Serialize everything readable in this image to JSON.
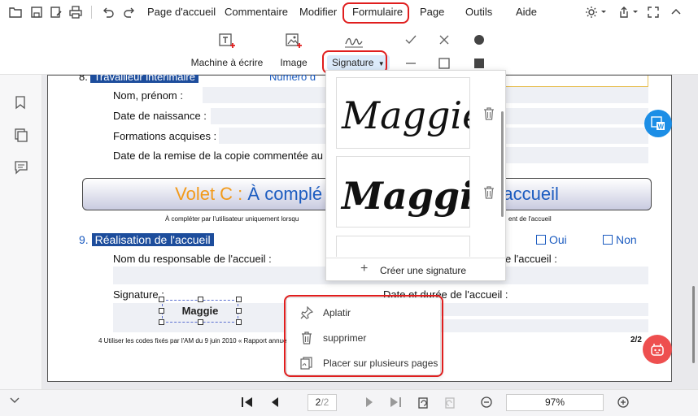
{
  "menu": {
    "items": [
      {
        "label": "Page d'accueil"
      },
      {
        "label": "Commentaire"
      },
      {
        "label": "Modifier"
      },
      {
        "label": "Formulaire"
      },
      {
        "label": "Page"
      },
      {
        "label": "Outils"
      },
      {
        "label": "Aide"
      }
    ],
    "active": "Formulaire"
  },
  "ribbon": {
    "typewriter_label": "Machine à écrire",
    "image_label": "Image",
    "signature_label": "Signature"
  },
  "document": {
    "section8_title": "Travailleur intérimaire",
    "section8_right": "Numéro d",
    "fields": {
      "name": "Nom, prénom :",
      "birth": "Date de naissance :",
      "training": "Formations acquises :",
      "copy_date": "Date de la remise de la copie commentée au t"
    },
    "volet_prefix": "Volet C :",
    "volet_text_left": "À complé",
    "volet_text_right": "accueil",
    "volet_note_left": "À compléter par l'utilisateur uniquement lorsqu",
    "volet_note_right": "ent de l'accueil",
    "section9_number": "9.",
    "section9_title": "Réalisation de l'accueil",
    "oui": "Oui",
    "non": "Non",
    "responsable": "Nom du responsable de l'accueil :",
    "responsable_right": "e l'accueil :",
    "signature_label": "Signature :",
    "date_duree": "Date et durée de l'accueil :",
    "placed_signature": "Maggie",
    "footnote": "4 Utiliser les codes fixés par l'AM du 9 juin 2010 « Rapport annuel",
    "page_marker": "2/2"
  },
  "signature_panel": {
    "signatures": [
      {
        "text": "Maggie",
        "style": "script-light"
      },
      {
        "text": "Maggie",
        "style": "script-bold"
      }
    ],
    "create_label": "Créer une signature"
  },
  "context_menu": {
    "items": [
      {
        "label": "Aplatir",
        "icon": "pin-icon"
      },
      {
        "label": "supprimer",
        "icon": "trash-icon"
      },
      {
        "label": "Placer sur plusieurs pages",
        "icon": "multi-page-icon"
      }
    ]
  },
  "bottom": {
    "page_current": "2",
    "page_total": "/2",
    "zoom": "97%"
  },
  "colors": {
    "accent_red": "#e01e1e",
    "section_blue": "#1d4d9c",
    "volet_orange": "#f29a1b",
    "word_button": "#1c8ee6",
    "ai_button": "#ee4f4f"
  }
}
